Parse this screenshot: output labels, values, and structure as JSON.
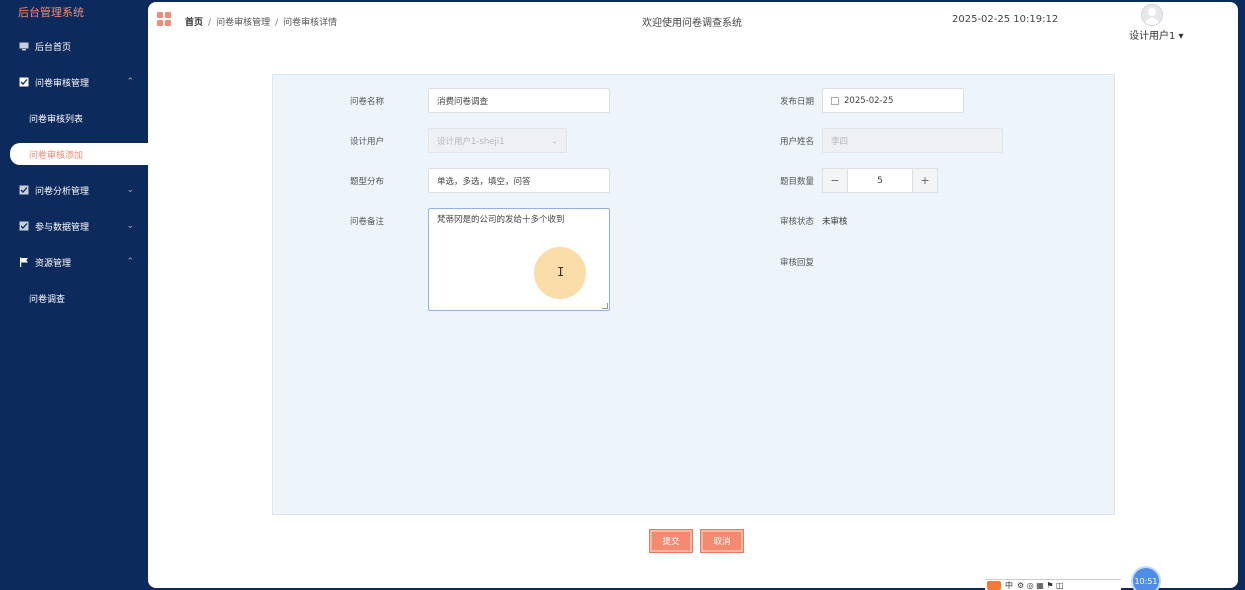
{
  "sidebar": {
    "brand": "后台管理系统",
    "items": [
      {
        "label": "后台首页",
        "icon": "monitor-icon"
      },
      {
        "label": "问卷审核管理",
        "icon": "checkbox-icon",
        "expanded": true,
        "children": [
          {
            "label": "问卷审核列表"
          },
          {
            "label": "问卷审核添加",
            "active": true
          }
        ]
      },
      {
        "label": "问卷分析管理",
        "icon": "checkbox-icon",
        "expanded": false
      },
      {
        "label": "参与数据管理",
        "icon": "checkbox-icon",
        "expanded": false
      },
      {
        "label": "资源管理",
        "icon": "flag-icon",
        "expanded": true,
        "children": [
          {
            "label": "问卷调查"
          }
        ]
      }
    ]
  },
  "header": {
    "breadcrumb": [
      "首页",
      "问卷审核管理",
      "问卷审核详情"
    ],
    "welcome": "欢迎使用问卷调查系统",
    "datetime": "2025-02-25 10:19:12",
    "user": "设计用户1"
  },
  "form": {
    "name_label": "问卷名称",
    "name_value": "消费问卷调查",
    "date_label": "发布日期",
    "date_value": "2025-02-25",
    "designer_label": "设计用户",
    "designer_value": "设计用户1-sheji1",
    "username_label": "用户姓名",
    "username_value": "李四",
    "types_label": "题型分布",
    "types_value": "单选，多选，填空，问答",
    "count_label": "题目数量",
    "count_value": "5",
    "count_minus": "−",
    "count_plus": "+",
    "remark_label": "问卷备注",
    "remark_value": "梵蒂冈是的公司的发给十多个收到",
    "status_label": "审核状态",
    "status_value": "未审核",
    "reply_label": "审核回复"
  },
  "actions": {
    "submit": "提交",
    "cancel": "取消"
  },
  "tray": {
    "clock": "10:51",
    "ime": "中"
  },
  "colors": {
    "sidebar_bg": "#0d2a5c",
    "accent": "#f48a70",
    "panel_bg": "#edf4fa"
  }
}
